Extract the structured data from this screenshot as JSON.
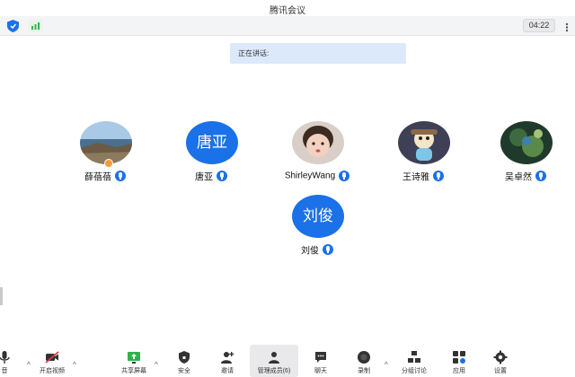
{
  "window": {
    "title": "腾讯会议"
  },
  "status": {
    "timer": "04:22"
  },
  "notice": {
    "text": "正在讲话:"
  },
  "participants": [
    {
      "name": "薛蓓蓓",
      "avatar_type": "photo",
      "host": true
    },
    {
      "name": "唐亚",
      "avatar_type": "text",
      "avatar_text": "唐亚"
    },
    {
      "name": "ShirleyWang",
      "avatar_type": "photo"
    },
    {
      "name": "王诗雅",
      "avatar_type": "photo"
    },
    {
      "name": "吴卓然",
      "avatar_type": "photo"
    },
    {
      "name": "刘俊",
      "avatar_type": "text",
      "avatar_text": "刘俊"
    }
  ],
  "toolbar": {
    "mute": "音",
    "video": "开启视频",
    "share": "共享屏幕",
    "security": "安全",
    "invite": "邀请",
    "members": "管理成员(6)",
    "chat": "聊天",
    "record": "录制",
    "breakout": "分组讨论",
    "apps": "应用",
    "settings": "设置"
  },
  "colors": {
    "accent": "#1b71e8",
    "notice_bg": "#dce9fb"
  },
  "icons": [
    "shield-icon",
    "signal-icon",
    "more-icon",
    "microphone-icon",
    "video-off-icon",
    "share-screen-icon",
    "security-icon",
    "invite-icon",
    "members-icon",
    "chat-icon",
    "record-icon",
    "breakout-icon",
    "apps-icon",
    "settings-icon"
  ]
}
